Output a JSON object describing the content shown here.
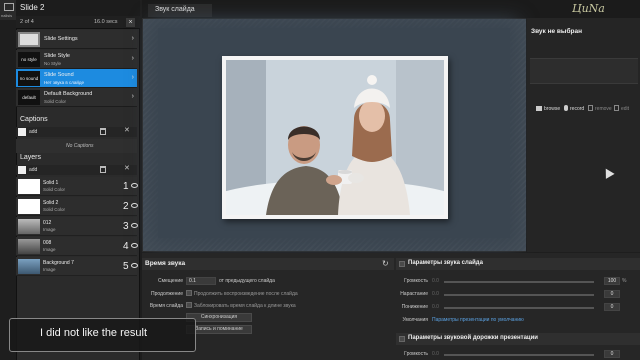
{
  "topleft": {
    "label": "nalisis"
  },
  "slide": {
    "title": "Slide 2",
    "page_of": "2 of 4",
    "duration": "16.0 secs"
  },
  "slide_rows": [
    {
      "thumb": "",
      "title": "Slide Settings",
      "sub": ""
    },
    {
      "thumb": "no style",
      "title": "Slide Style",
      "sub": "No Style"
    },
    {
      "thumb": "no sound",
      "title": "Slide Sound",
      "sub": "Нет звука в слайде"
    },
    {
      "thumb": "default",
      "title": "Default Background",
      "sub": "Solid Color"
    }
  ],
  "captions": {
    "title": "Captions",
    "add": "add",
    "empty": "No Captions"
  },
  "layers": {
    "title": "Layers",
    "add": "add",
    "items": [
      {
        "name": "Solid 1",
        "type": "Solid Color",
        "num": "1",
        "thumb": "#ffffff"
      },
      {
        "name": "Solid 2",
        "type": "Solid Color",
        "num": "2",
        "thumb": "#ffffff"
      },
      {
        "name": "012",
        "type": "Image",
        "num": "3",
        "thumb": "#8a8a8a"
      },
      {
        "name": "008",
        "type": "Image",
        "num": "4",
        "thumb": "#6d6d6d"
      },
      {
        "name": "Background 7",
        "type": "Image",
        "num": "5",
        "thumb": "#5b7287"
      }
    ]
  },
  "tab": {
    "label": "Звук слайда"
  },
  "right": {
    "no_voice": "Звук не выбран",
    "buttons": [
      "browse",
      "record",
      "remove",
      "edit"
    ]
  },
  "sound_time": {
    "title": "Время звука",
    "offset_label": "Смещение",
    "offset_value": "0.1",
    "offset_suffix": "от предыдущего слайда",
    "continue_label": "Продолжение",
    "continue_text": "Продолжить воспроизведение после слайда",
    "slide_time_label": "Время слайда",
    "slide_time_text": "Заблокировать время слайда к длине звука",
    "sync_button": "Синхронизация",
    "record_button": "Запись и поминание"
  },
  "slide_sound_params": {
    "title": "Параметры звука слайда",
    "rows": [
      {
        "label": "Громкость",
        "value": "0.0",
        "pct": "100"
      },
      {
        "label": "Нарастание",
        "value": "0.0",
        "pct": "0"
      },
      {
        "label": "Понижение",
        "value": "0.0",
        "pct": "0"
      }
    ],
    "defaults_label": "Умолчания",
    "defaults_link": "Параметры презентации по умолчанию"
  },
  "track_params": {
    "title": "Параметры звуковой дорожки презентации",
    "rows": [
      {
        "label": "Громкость",
        "value": "0.0",
        "pct": "0"
      }
    ]
  },
  "toast": {
    "text": "I did not like the result"
  },
  "logo": {
    "text": "ЦиNa"
  },
  "colors": {
    "accent": "#1d8be0",
    "panel": "#2b2b2b",
    "link": "#5aa0e0"
  }
}
